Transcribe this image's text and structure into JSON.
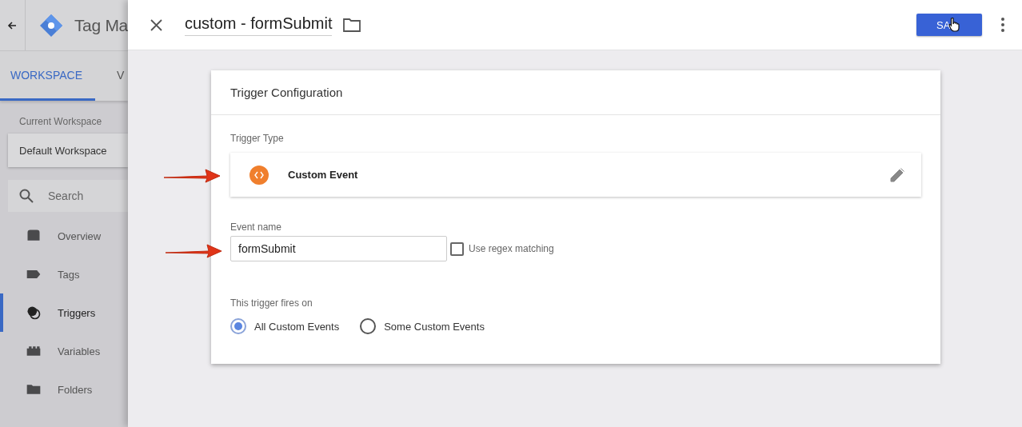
{
  "app": {
    "title": "Tag Ma"
  },
  "tabs": [
    {
      "label": "WORKSPACE",
      "selected": true
    },
    {
      "label": "V",
      "selected": false
    }
  ],
  "workspace": {
    "label": "Current Workspace",
    "name": "Default Workspace"
  },
  "search": {
    "placeholder": "Search"
  },
  "nav": [
    {
      "label": "Overview",
      "kind": "overview",
      "selected": false
    },
    {
      "label": "Tags",
      "kind": "tags",
      "selected": false
    },
    {
      "label": "Triggers",
      "kind": "triggers",
      "selected": true
    },
    {
      "label": "Variables",
      "kind": "variables",
      "selected": false
    },
    {
      "label": "Folders",
      "kind": "folders",
      "selected": false
    }
  ],
  "editor": {
    "title": "custom - formSubmit",
    "save": "SA"
  },
  "card": {
    "title": "Trigger Configuration",
    "trigger_type": {
      "label": "Trigger Type",
      "name": "Custom Event"
    },
    "event_name": {
      "label": "Event name",
      "value": "formSubmit"
    },
    "regex": {
      "label": "Use regex matching",
      "checked": false
    },
    "fires_on": {
      "label": "This trigger fires on",
      "options": [
        {
          "label": "All Custom Events",
          "selected": true
        },
        {
          "label": "Some Custom Events",
          "selected": false
        }
      ]
    }
  }
}
